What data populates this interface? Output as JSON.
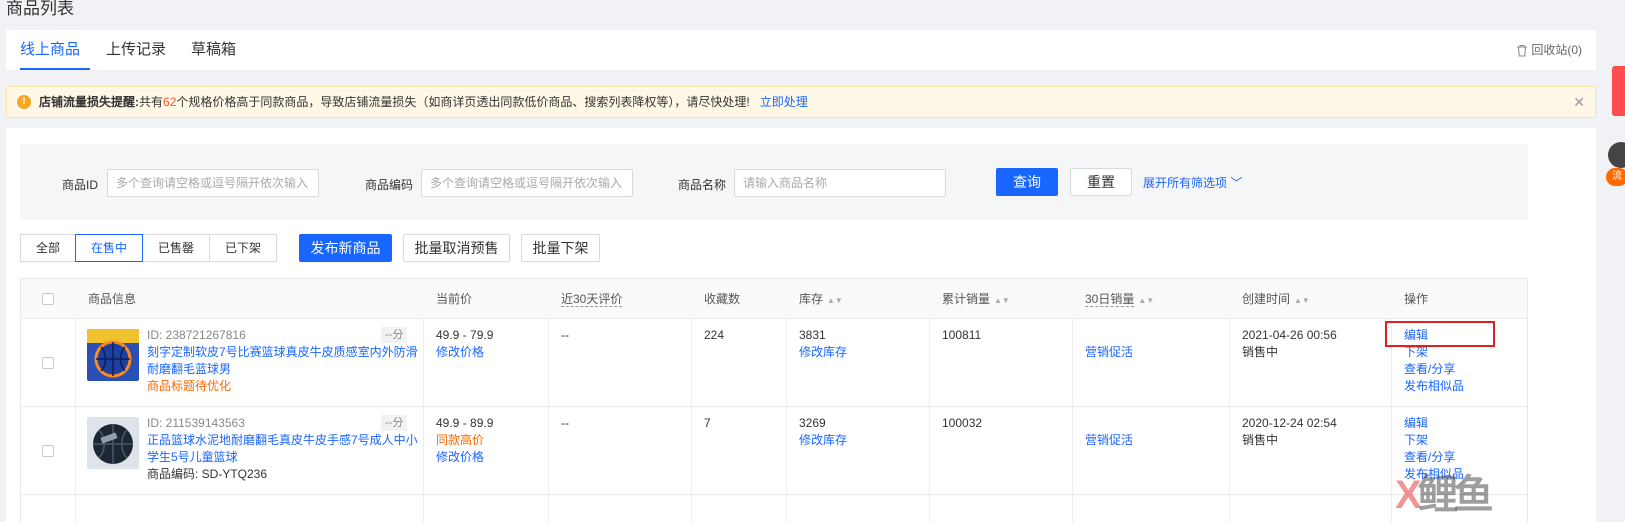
{
  "page_title": "商品列表",
  "tabs": [
    {
      "label": "线上商品",
      "active": true
    },
    {
      "label": "上传记录",
      "active": false
    },
    {
      "label": "草稿箱",
      "active": false
    }
  ],
  "recycle": "回收站(0)",
  "alert": {
    "title": "店铺流量损失提醒:",
    "text_before": "共有",
    "count": "62",
    "text_after": "个规格价格高于同款商品，导致店铺流量损失（如商详页透出同款低价商品、搜索列表降权等），请尽快处理!",
    "link": "立即处理"
  },
  "filters": {
    "id_label": "商品ID",
    "id_placeholder": "多个查询请空格或逗号隔开依次输入",
    "code_label": "商品编码",
    "code_placeholder": "多个查询请空格或逗号隔开依次输入",
    "name_label": "商品名称",
    "name_placeholder": "请输入商品名称",
    "query_btn": "查询",
    "reset_btn": "重置",
    "expand": "展开所有筛选项"
  },
  "status_tabs": [
    "全部",
    "在售中",
    "已售罄",
    "已下架"
  ],
  "active_status": 1,
  "actions": {
    "publish": "发布新商品",
    "cancel_presale": "批量取消预售",
    "batch_off": "批量下架"
  },
  "columns": {
    "info": "商品信息",
    "price": "当前价",
    "review": "近30天评价",
    "fav": "收藏数",
    "stock": "库存",
    "sales": "累计销量",
    "sales30": "30日销量",
    "created": "创建时间",
    "ops": "操作"
  },
  "rows": [
    {
      "id": "ID: 238721267816",
      "score": "--分",
      "title1": "刻字定制软皮7号比赛篮球真皮牛皮质感室内外防滑",
      "title2": "耐磨翻毛蓝球男",
      "note": "商品标题待优化",
      "price": "49.9 - 79.9",
      "price_link": "修改价格",
      "review": "--",
      "fav": "224",
      "stock": "3831",
      "stock_link": "修改库存",
      "sales": "100811",
      "sales30_link": "营销促活",
      "created": "2021-04-26 00:56",
      "status": "销售中",
      "ops": [
        "编辑",
        "下架",
        "查看/分享",
        "发布相似品"
      ]
    },
    {
      "id": "ID: 211539143563",
      "score": "--分",
      "title1": "正品篮球水泥地耐磨翻毛真皮牛皮手感7号成人中小",
      "title2": "学生5号儿童篮球",
      "note": "商品编码: SD-YTQ236",
      "price": "49.9 - 89.9",
      "price_tag": "同款高价",
      "price_link": "修改价格",
      "review": "--",
      "fav": "7",
      "stock": "3269",
      "stock_link": "修改库存",
      "sales": "100032",
      "sales30_link": "营销促活",
      "created": "2020-12-24 02:54",
      "status": "销售中",
      "ops": [
        "编辑",
        "下架",
        "查看/分享",
        "发布相似品"
      ]
    }
  ],
  "side_badge": "流",
  "watermark": {
    "part1": "X",
    "part2": "鲤鱼"
  }
}
